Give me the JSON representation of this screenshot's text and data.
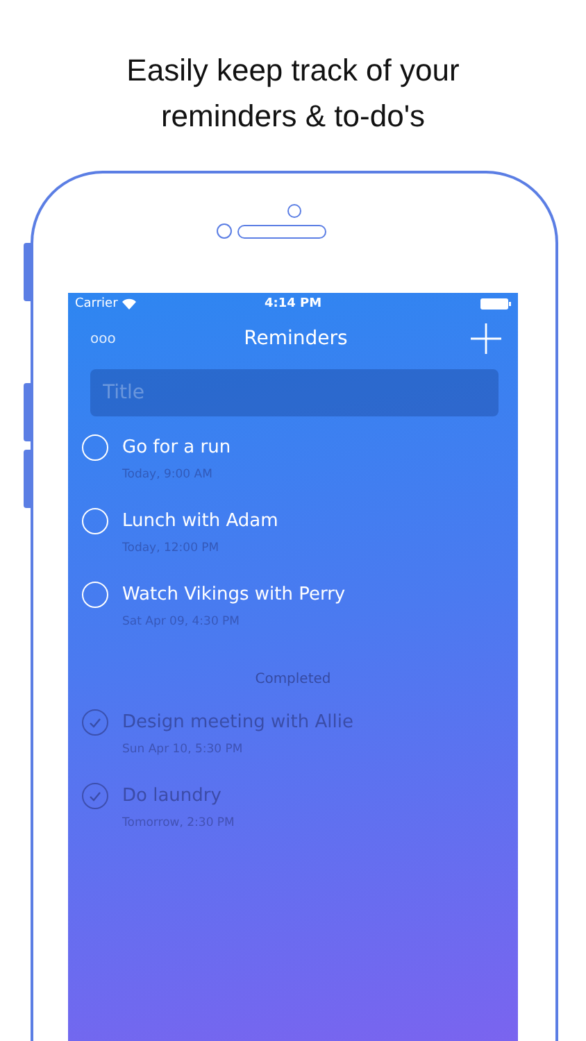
{
  "headline": "Easily keep track of your reminders & to-do's",
  "status_bar": {
    "carrier": "Carrier",
    "time": "4:14 PM"
  },
  "nav": {
    "menu": "ooo",
    "title": "Reminders"
  },
  "title_field": {
    "placeholder": "Title"
  },
  "reminders": [
    {
      "title": "Go for a run",
      "due": "Today, 9:00 AM",
      "completed": false
    },
    {
      "title": "Lunch with Adam",
      "due": "Today, 12:00 PM",
      "completed": false
    },
    {
      "title": "Watch Vikings with Perry",
      "due": "Sat Apr 09, 4:30 PM",
      "completed": false
    }
  ],
  "completed_section": {
    "heading": "Completed",
    "items": [
      {
        "title": "Design meeting with Allie",
        "due": "Sun Apr 10, 5:30 PM",
        "completed": true
      },
      {
        "title": "Do laundry",
        "due": "Tomorrow, 2:30 PM",
        "completed": true
      }
    ]
  }
}
